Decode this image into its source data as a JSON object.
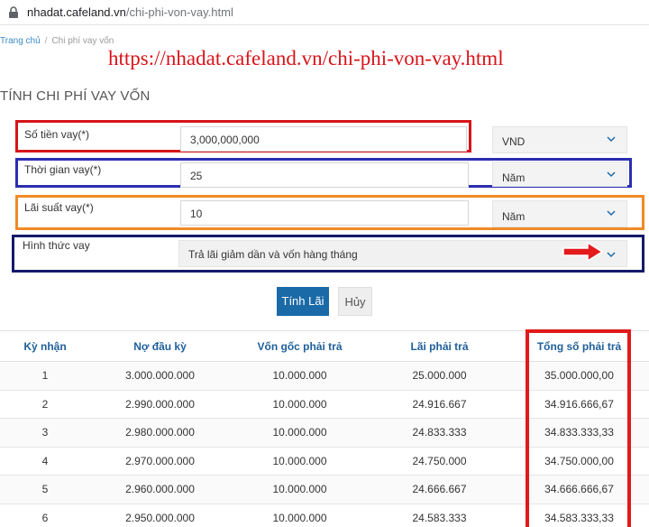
{
  "browser": {
    "url_domain": "nhadat.cafeland.vn",
    "url_path": "/chi-phi-von-vay.html"
  },
  "breadcrumb": {
    "home": "Trang chủ",
    "separator": "/",
    "current": "Chi phí vay vốn"
  },
  "overlay_url": "https://nhadat.cafeland.vn/chi-phi-von-vay.html",
  "page_title": "TÍNH CHI PHÍ VAY VỐN",
  "form": {
    "amount": {
      "label": "Số tiền vay(*)",
      "value": "3,000,000,000",
      "unit": "VND"
    },
    "term": {
      "label": "Thời gian vay(*)",
      "value": "25",
      "unit": "Năm"
    },
    "rate": {
      "label": "Lãi suất vay(*)",
      "value": "10",
      "unit": "Năm"
    },
    "method": {
      "label": "Hình thức vay",
      "value": "Trả lãi giảm dần và vốn hàng tháng"
    }
  },
  "buttons": {
    "calculate": "Tính Lãi",
    "cancel": "Hủy"
  },
  "table": {
    "headers": [
      "Kỳ nhận",
      "Nợ đầu kỳ",
      "Vốn gốc phải trả",
      "Lãi phải trả",
      "Tổng số phải trả"
    ],
    "rows": [
      [
        "1",
        "3.000.000.000",
        "10.000.000",
        "25.000.000",
        "35.000.000,00"
      ],
      [
        "2",
        "2.990.000.000",
        "10.000.000",
        "24.916.667",
        "34.916.666,67"
      ],
      [
        "3",
        "2.980.000.000",
        "10.000.000",
        "24.833.333",
        "34.833.333,33"
      ],
      [
        "4",
        "2.970.000.000",
        "10.000.000",
        "24.750.000",
        "34.750.000,00"
      ],
      [
        "5",
        "2.960.000.000",
        "10.000.000",
        "24.666.667",
        "34.666.666,67"
      ],
      [
        "6",
        "2.950.000.000",
        "10.000.000",
        "24.583.333",
        "34.583.333,33"
      ]
    ]
  },
  "colors": {
    "frame_amount": "#d6141a",
    "frame_term": "#2b2fb0",
    "frame_rate": "#f08a26",
    "frame_method": "#141a6a",
    "highlight": "#e01a1a",
    "primary_button": "#1a6aa8",
    "header_text": "#1f5f9a"
  },
  "icons": {
    "lock": "lock-icon",
    "chevron": "chevron-down-icon",
    "arrow": "red-arrow-right-icon"
  }
}
